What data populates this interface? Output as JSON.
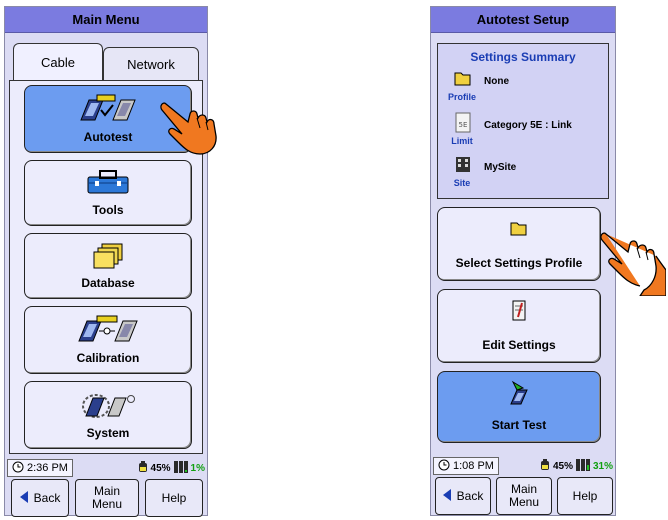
{
  "left": {
    "title": "Main Menu",
    "tabs": [
      {
        "label": "Cable"
      },
      {
        "label": "Network"
      }
    ],
    "menu": [
      {
        "label": "Autotest"
      },
      {
        "label": "Tools"
      },
      {
        "label": "Database"
      },
      {
        "label": "Calibration"
      },
      {
        "label": "System"
      }
    ],
    "status": {
      "time": "2:36 PM",
      "battery": "45%",
      "memory": "1%"
    },
    "buttons": {
      "back": "Back",
      "main_menu": "Main Menu",
      "help": "Help"
    }
  },
  "right": {
    "title": "Autotest Setup",
    "summary": {
      "heading": "Settings Summary",
      "rows": [
        {
          "caption": "Profile",
          "value": "None"
        },
        {
          "caption": "Limit",
          "value": "Category 5E : Link",
          "icon_text": "5E"
        },
        {
          "caption": "Site",
          "value": "MySite"
        }
      ]
    },
    "actions": [
      {
        "label": "Select Settings Profile"
      },
      {
        "label": "Edit Settings"
      },
      {
        "label": "Start Test"
      }
    ],
    "status": {
      "time": "1:08 PM",
      "battery": "45%",
      "memory": "31%"
    },
    "buttons": {
      "back": "Back",
      "main_menu": "Main Menu",
      "help": "Help"
    }
  },
  "colors": {
    "titlebar": "#7b7be0",
    "panel": "#dcdcf4",
    "active_button": "#6c9cf0",
    "accent_text": "#1a3db4",
    "hand": "#f07820"
  },
  "icons": [
    "clock-icon",
    "battery-icon",
    "memory-icon",
    "back-arrow-icon",
    "folder-icon",
    "toolbox-icon",
    "database-icon",
    "gear-icon",
    "hand-pointer-icon"
  ]
}
